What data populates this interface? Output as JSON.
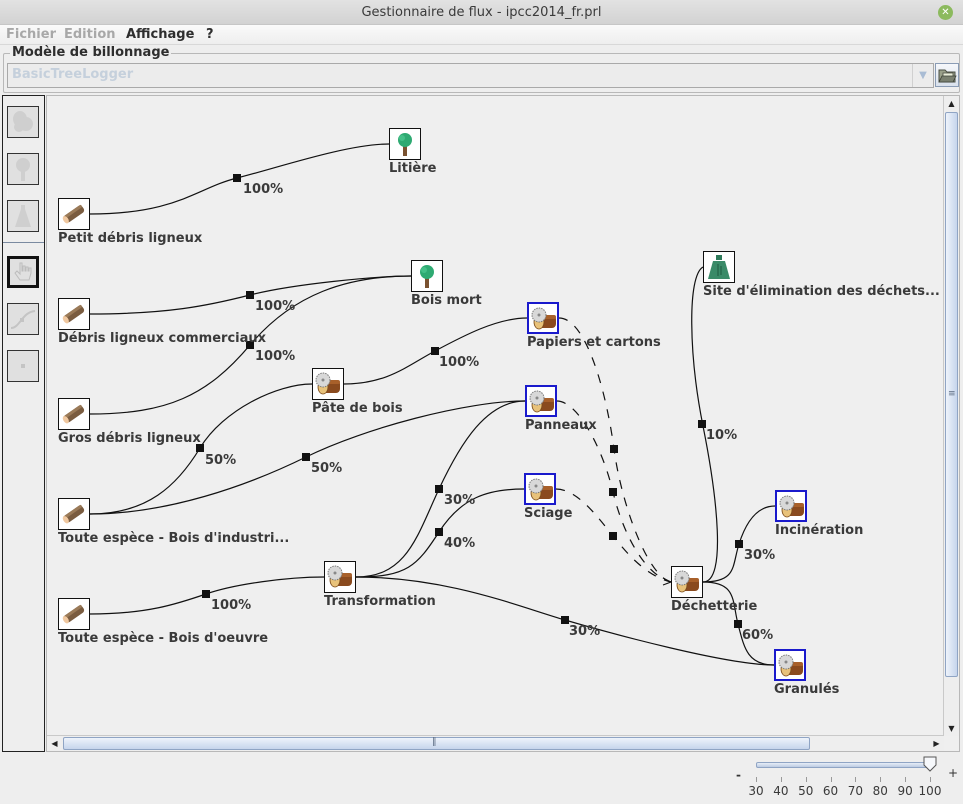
{
  "window": {
    "title": "Gestionnaire de flux - ipcc2014_fr.prl",
    "close_icon": "close-icon"
  },
  "menu": {
    "items": [
      {
        "label": "Fichier",
        "enabled": false
      },
      {
        "label": "Edition",
        "enabled": false
      },
      {
        "label": "Affichage",
        "enabled": true
      },
      {
        "label": "?",
        "enabled": true
      }
    ]
  },
  "logging_model": {
    "group_label": "Modèle de billonnage",
    "selected_value": "BasicTreeLogger",
    "open_button_icon": "folder-open-icon"
  },
  "toolbox": {
    "tools": [
      {
        "name": "leaves-tool",
        "icon": "leaves-icon",
        "active": false
      },
      {
        "name": "tree-tool",
        "icon": "tree-icon",
        "active": false
      },
      {
        "name": "landfill-tool",
        "icon": "landfill-icon",
        "active": false
      },
      {
        "name": "hand-tool",
        "icon": "hand-pointer-icon",
        "active": true
      },
      {
        "name": "link-tool",
        "icon": "curve-link-icon",
        "active": false
      },
      {
        "name": "point-tool",
        "icon": "point-icon",
        "active": false
      }
    ]
  },
  "graph": {
    "nodes": [
      {
        "id": "petit",
        "label": "Petit débris ligneux",
        "icon": "log-icon",
        "selected": false
      },
      {
        "id": "litiere",
        "label": "Litière",
        "icon": "tree-icon",
        "selected": false
      },
      {
        "id": "debris_comm",
        "label": "Débris ligneux commerciaux",
        "icon": "log-icon",
        "selected": false
      },
      {
        "id": "bois_mort",
        "label": "Bois mort",
        "icon": "tree-icon",
        "selected": false
      },
      {
        "id": "gros",
        "label": "Gros débris ligneux",
        "icon": "log-icon",
        "selected": false
      },
      {
        "id": "pate",
        "label": "Pâte de bois",
        "icon": "sawmill-icon",
        "selected": false
      },
      {
        "id": "papiers",
        "label": "Papiers et cartons",
        "icon": "sawmill-icon",
        "selected": true
      },
      {
        "id": "panneaux",
        "label": "Panneaux",
        "icon": "sawmill-icon",
        "selected": true
      },
      {
        "id": "sciage",
        "label": "Sciage",
        "icon": "sawmill-icon",
        "selected": true
      },
      {
        "id": "industrie",
        "label": "Toute espèce - Bois d'industri...",
        "icon": "log-icon",
        "selected": false
      },
      {
        "id": "oeuvre",
        "label": "Toute espèce - Bois d'oeuvre",
        "icon": "log-icon",
        "selected": false
      },
      {
        "id": "transformation",
        "label": "Transformation",
        "icon": "sawmill-icon",
        "selected": false
      },
      {
        "id": "site",
        "label": "Site d'élimination des déchets...",
        "icon": "landfill-icon",
        "selected": false
      },
      {
        "id": "dechetterie",
        "label": "Déchetterie",
        "icon": "sawmill-icon",
        "selected": false
      },
      {
        "id": "incineration",
        "label": "Incinération",
        "icon": "sawmill-icon",
        "selected": true
      },
      {
        "id": "granules",
        "label": "Granulés",
        "icon": "sawmill-icon",
        "selected": true
      }
    ],
    "links": [
      {
        "from": "petit",
        "to": "litiere",
        "percent": "100%",
        "dashed": false
      },
      {
        "from": "debris_comm",
        "to": "bois_mort",
        "percent": "100%",
        "dashed": false
      },
      {
        "from": "gros",
        "to": "bois_mort",
        "percent": "100%",
        "dashed": false
      },
      {
        "from": "pate",
        "to": "papiers",
        "percent": "100%",
        "dashed": false
      },
      {
        "from": "industrie",
        "to": "pate",
        "percent": "50%",
        "dashed": false
      },
      {
        "from": "industrie",
        "to": "panneaux",
        "percent": "50%",
        "dashed": false
      },
      {
        "from": "oeuvre",
        "to": "transformation",
        "percent": "100%",
        "dashed": false
      },
      {
        "from": "transformation",
        "to": "panneaux",
        "percent": "30%",
        "dashed": false
      },
      {
        "from": "transformation",
        "to": "sciage",
        "percent": "40%",
        "dashed": false
      },
      {
        "from": "transformation",
        "to": "granules",
        "percent": "30%",
        "dashed": false
      },
      {
        "from": "papiers",
        "to": "dechetterie",
        "percent": "",
        "dashed": true
      },
      {
        "from": "panneaux",
        "to": "dechetterie",
        "percent": "",
        "dashed": true
      },
      {
        "from": "sciage",
        "to": "dechetterie",
        "percent": "",
        "dashed": true
      },
      {
        "from": "dechetterie",
        "to": "site",
        "percent": "10%",
        "dashed": false
      },
      {
        "from": "dechetterie",
        "to": "incineration",
        "percent": "30%",
        "dashed": false
      },
      {
        "from": "dechetterie",
        "to": "granules",
        "percent": "60%",
        "dashed": false
      }
    ]
  },
  "zoom": {
    "minus_label": "-",
    "plus_label": "+",
    "ticks": [
      "30",
      "40",
      "50",
      "60",
      "70",
      "80",
      "90",
      "100"
    ],
    "value": 100
  }
}
